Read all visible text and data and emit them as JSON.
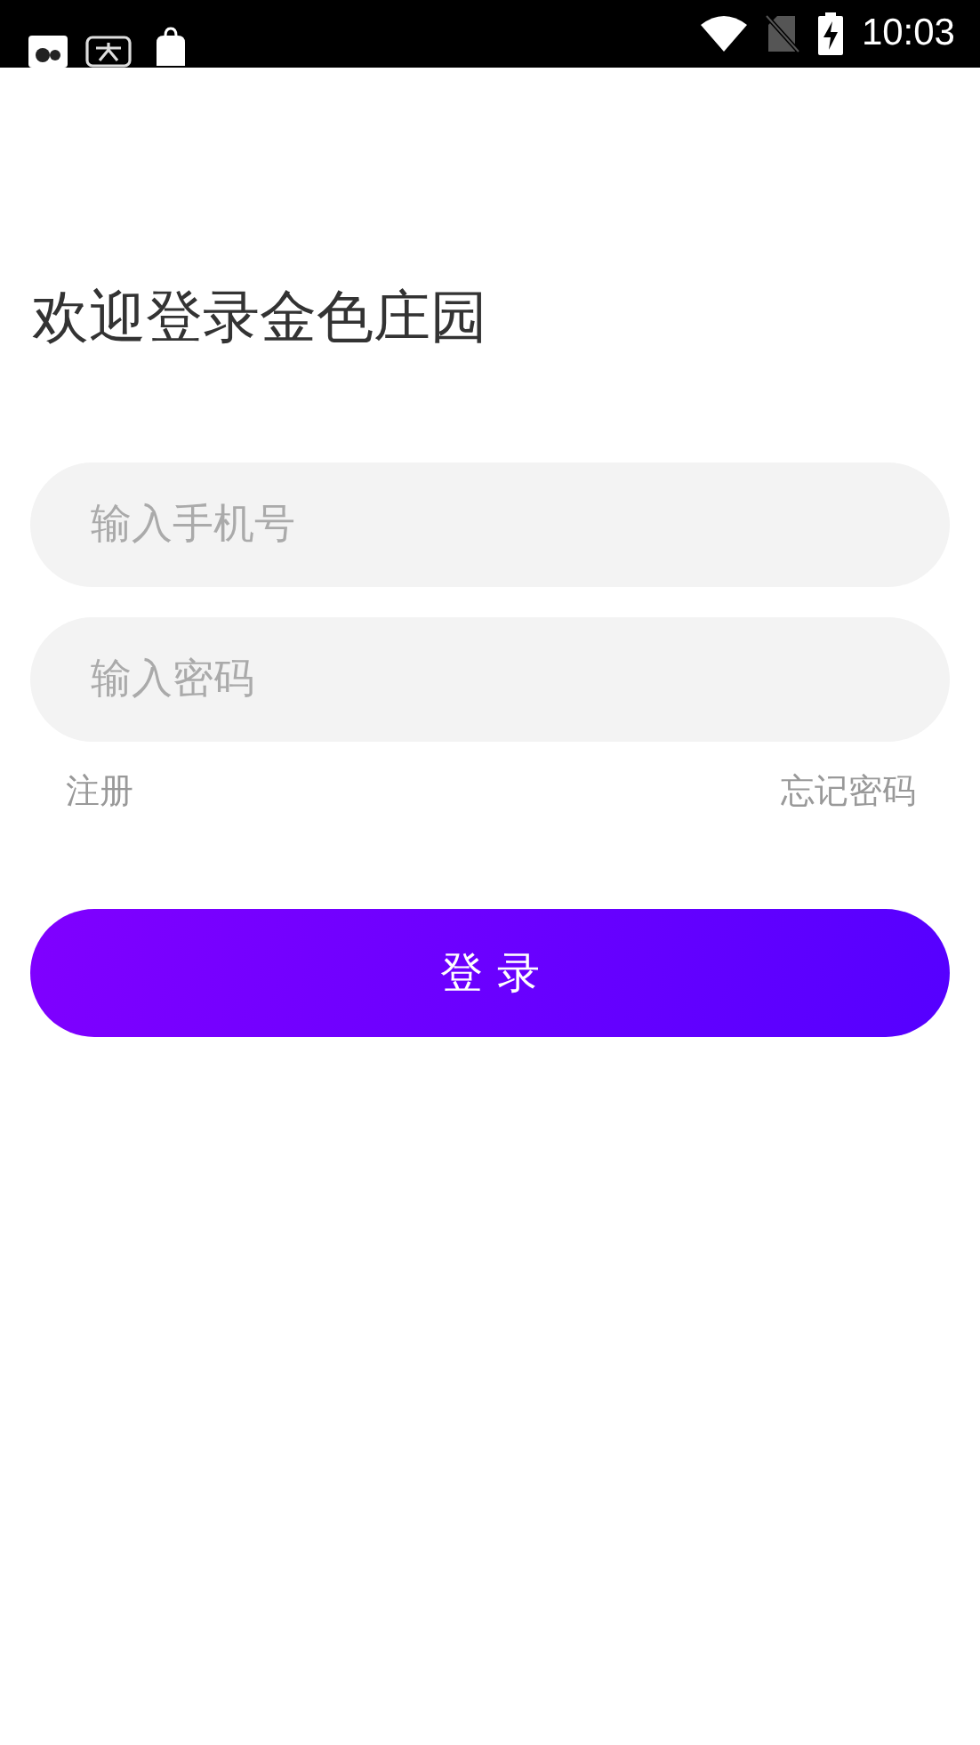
{
  "status_bar": {
    "time": "10:03"
  },
  "title": "欢迎登录金色庄园",
  "phone_field": {
    "placeholder": "输入手机号"
  },
  "password_field": {
    "placeholder": "输入密码"
  },
  "links": {
    "register": "注册",
    "forgot_password": "忘记密码"
  },
  "login_button": "登 录"
}
